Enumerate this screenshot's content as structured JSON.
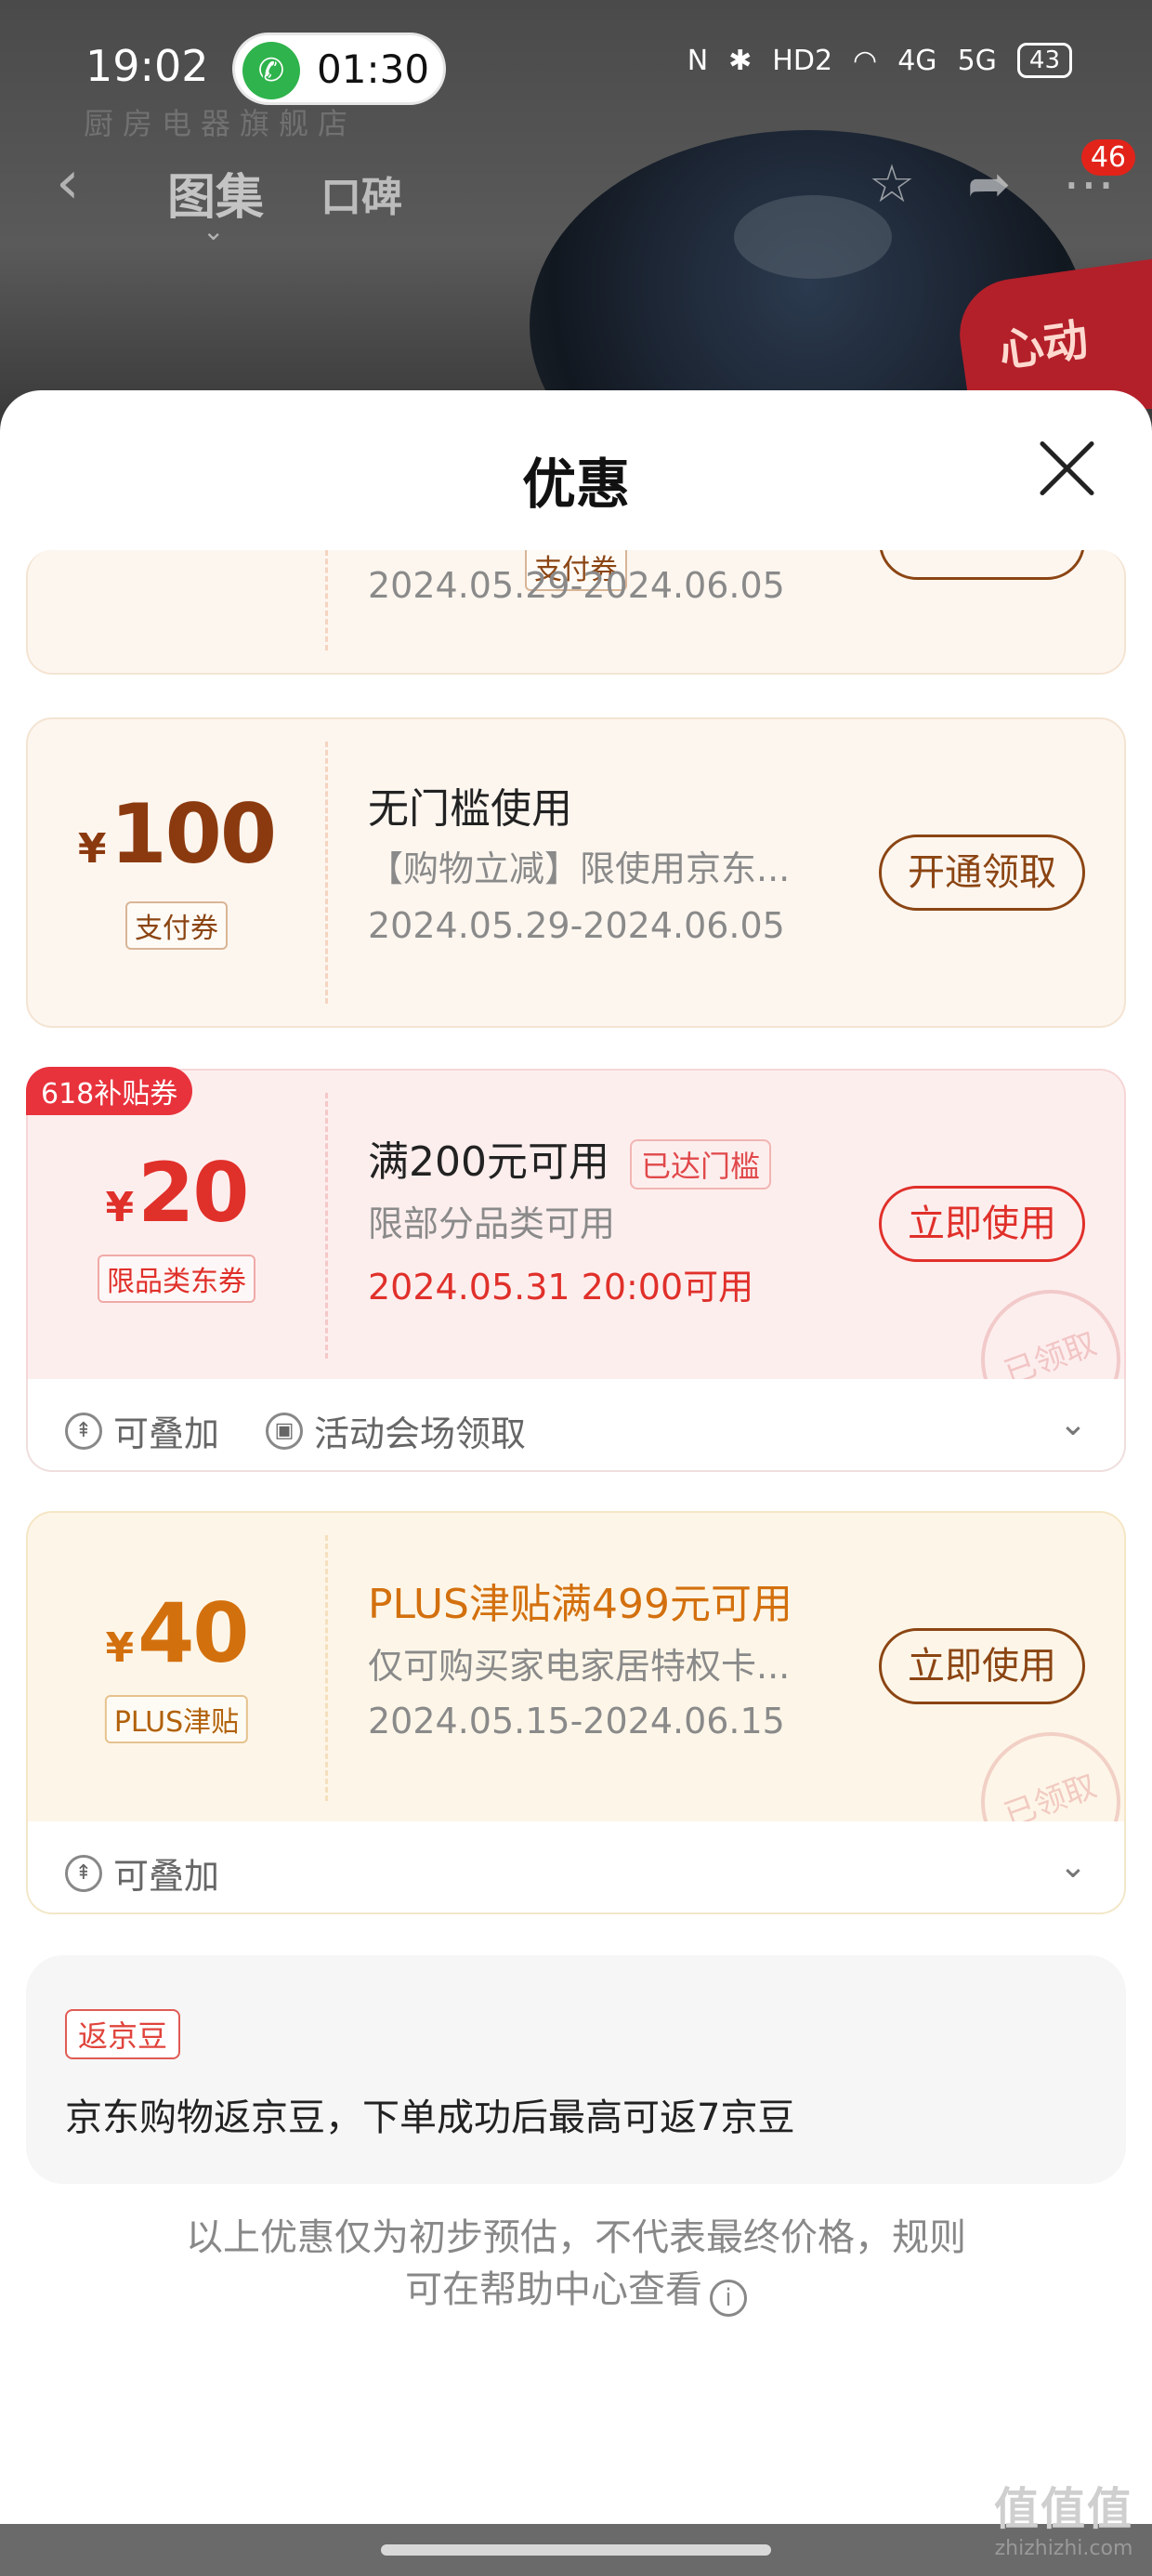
{
  "status_bar": {
    "time": "19:02",
    "call_timer": "01:30",
    "battery": "43",
    "net_labels": [
      "HD2",
      "4G",
      "5G"
    ]
  },
  "background": {
    "shop_text": "厨房电器旗舰店",
    "badge": "心动",
    "nav_tabs": [
      "图集",
      "口碑"
    ],
    "message_count": "46"
  },
  "sheet": {
    "title": "优惠"
  },
  "coupons": [
    {
      "tag": "支付券",
      "date": "2024.05.29-2024.06.05"
    },
    {
      "yen": "¥",
      "amount": "100",
      "tag": "支付券",
      "title": "无门槛使用",
      "desc": "【购物立减】限使用京东...",
      "date": "2024.05.29-2024.06.05",
      "button": "开通领取"
    },
    {
      "badge": "618补贴券",
      "yen": "¥",
      "amount": "20",
      "tag": "限品类东券",
      "title": "满200元可用",
      "reached": "已达门槛",
      "desc": "限部分品类可用",
      "date": "2024.05.31 20:00可用",
      "button": "立即使用",
      "stamp": "已领取",
      "footer": {
        "stackable": "可叠加",
        "source": "活动会场领取"
      }
    },
    {
      "yen": "¥",
      "amount": "40",
      "tag": "PLUS津贴",
      "title": "PLUS津贴满499元可用",
      "desc": "仅可购买家电家居特权卡...",
      "date": "2024.05.15-2024.06.15",
      "button": "立即使用",
      "stamp": "已领取",
      "footer": {
        "stackable": "可叠加"
      }
    }
  ],
  "jd_beans": {
    "tag": "返京豆",
    "text": "京东购物返京豆，下单成功后最高可返7京豆"
  },
  "note": {
    "line1": "以上优惠仅为初步预估，不代表最终价格，规则",
    "line2": "可在帮助中心查看"
  },
  "watermark": {
    "logo": "值值值",
    "site": "zhizhizhi.com"
  },
  "colors": {
    "brown": "#8b4513",
    "red": "#e0302a",
    "orange": "#d3700e"
  }
}
